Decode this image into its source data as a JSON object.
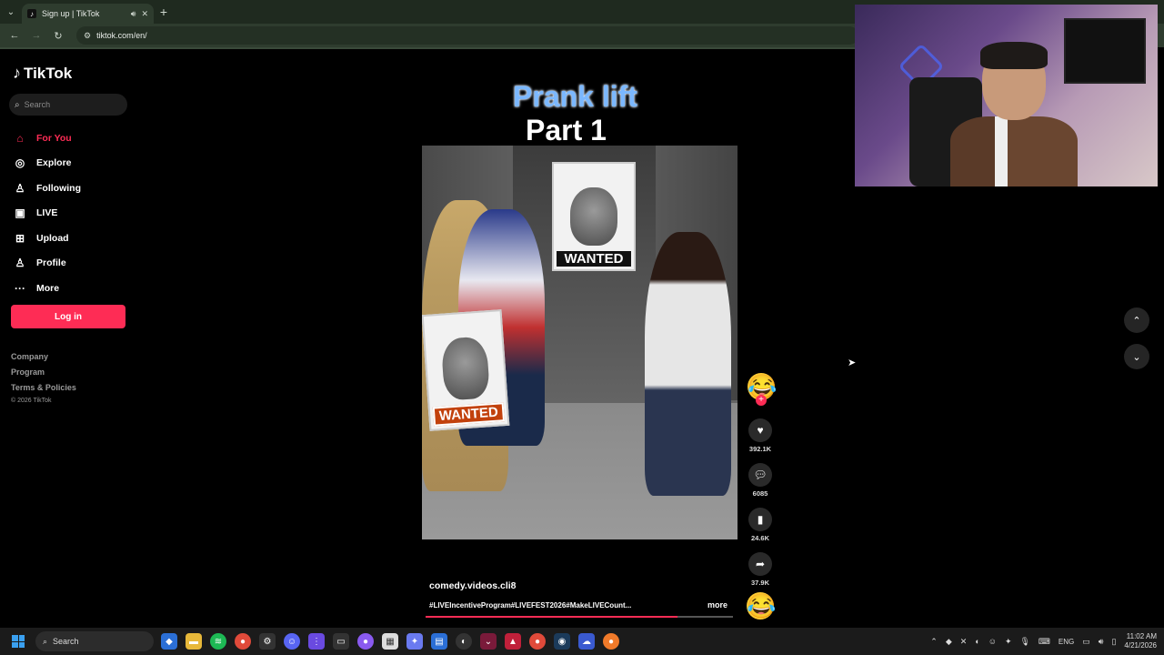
{
  "browser": {
    "tab_title": "Sign up | TikTok",
    "url": "tiktok.com/en/"
  },
  "sidebar": {
    "logo_text": "TikTok",
    "search_placeholder": "Search",
    "nav": [
      {
        "label": "For You",
        "icon": "home-icon"
      },
      {
        "label": "Explore",
        "icon": "compass-icon"
      },
      {
        "label": "Following",
        "icon": "person-icon"
      },
      {
        "label": "LIVE",
        "icon": "live-icon"
      },
      {
        "label": "Upload",
        "icon": "plus-square-icon"
      },
      {
        "label": "Profile",
        "icon": "person-icon"
      },
      {
        "label": "More",
        "icon": "dots-icon"
      }
    ],
    "login_label": "Log in",
    "footer": {
      "company": "Company",
      "program": "Program",
      "terms": "Terms & Policies",
      "copyright": "© 2026 TikTok"
    }
  },
  "video": {
    "title_line1": "Prank lift",
    "title_line2": "Part 1",
    "poster_text": "WANTED",
    "poster_text2": "WANTED",
    "author": "comedy.videos.cli8",
    "hashtags": "#LIVEIncentiveProgram#LIVEFEST2026#MakeLIVECount...",
    "more_label": "more",
    "progress": 0.82
  },
  "actions": {
    "likes": "392.1K",
    "comments": "6085",
    "saves": "24.6K",
    "shares": "37.9K"
  },
  "taskbar": {
    "search_label": "Search",
    "language": "ENG",
    "time": "11:02 AM",
    "date": "4/21/2026"
  },
  "colors": {
    "accent": "#fe2c55",
    "title_blue": "#7bb8ff",
    "browser_chrome": "#2e3c2e"
  }
}
